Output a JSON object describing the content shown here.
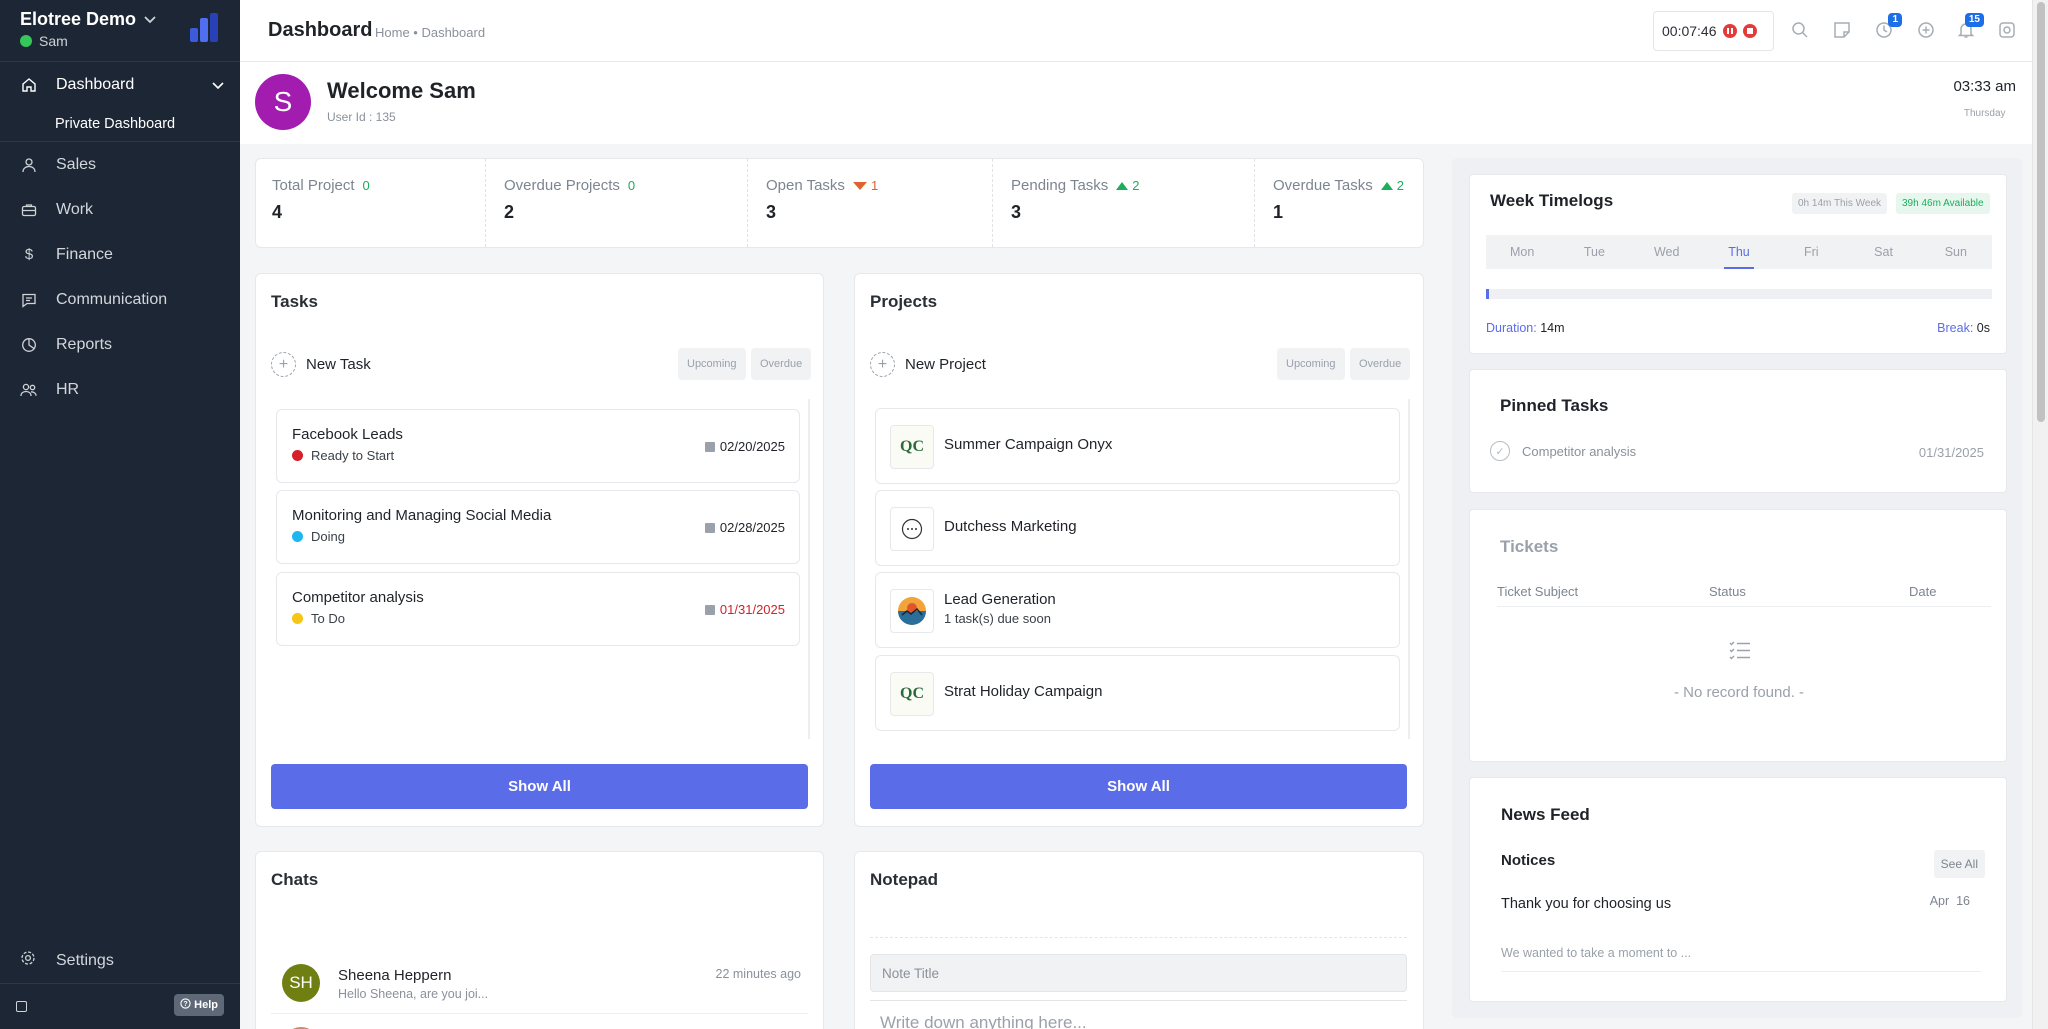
{
  "sidebar": {
    "company": "Elotree Demo",
    "user": "Sam",
    "nav": [
      {
        "label": "Dashboard",
        "icon": "home-icon"
      },
      {
        "label": "Private Dashboard"
      },
      {
        "label": "Sales",
        "icon": "user-icon"
      },
      {
        "label": "Work",
        "icon": "briefcase-icon"
      },
      {
        "label": "Finance",
        "icon": "dollar-icon"
      },
      {
        "label": "Communication",
        "icon": "message-icon"
      },
      {
        "label": "Reports",
        "icon": "pie-chart-icon"
      },
      {
        "label": "HR",
        "icon": "users-icon"
      }
    ],
    "settings": "Settings",
    "help": "Help"
  },
  "topbar": {
    "title": "Dashboard",
    "breadcrumb": "Home • Dashboard",
    "timer": "00:07:46",
    "clock_badge": "1",
    "notif_badge": "15"
  },
  "welcome": {
    "avatar_letter": "S",
    "greeting": "Welcome Sam",
    "user_id": "User Id : 135",
    "time": "03:33 am",
    "day": "Thursday",
    "avatar_color": "#a21caf"
  },
  "stats": [
    {
      "label": "Total Project",
      "delta": "0",
      "trend": "none",
      "value": "4"
    },
    {
      "label": "Overdue Projects",
      "delta": "0",
      "trend": "none",
      "value": "2"
    },
    {
      "label": "Open Tasks",
      "delta": "1",
      "trend": "down",
      "value": "3"
    },
    {
      "label": "Pending Tasks",
      "delta": "2",
      "trend": "up",
      "value": "3"
    },
    {
      "label": "Overdue Tasks",
      "delta": "2",
      "trend": "up",
      "value": "1"
    }
  ],
  "tasks": {
    "title": "Tasks",
    "new_label": "New Task",
    "filter_upcoming": "Upcoming",
    "filter_overdue": "Overdue",
    "items": [
      {
        "name": "Facebook Leads",
        "status": "Ready to Start",
        "status_color": "#d61f26",
        "date": "02/20/2025",
        "overdue": false
      },
      {
        "name": "Monitoring and Managing Social Media",
        "status": "Doing",
        "status_color": "#1fb6f0",
        "date": "02/28/2025",
        "overdue": false
      },
      {
        "name": "Competitor analysis",
        "status": "To Do",
        "status_color": "#f5c518",
        "date": "01/31/2025",
        "overdue": true
      }
    ],
    "show_all": "Show All"
  },
  "projects": {
    "title": "Projects",
    "new_label": "New Project",
    "filter_upcoming": "Upcoming",
    "filter_overdue": "Overdue",
    "items": [
      {
        "name": "Summer Campaign Onyx",
        "sub": "",
        "logo": "QC"
      },
      {
        "name": "Dutchess Marketing",
        "sub": "",
        "logo": "dots"
      },
      {
        "name": "Lead Generation",
        "sub": "1 task(s) due soon",
        "logo": "sunset"
      },
      {
        "name": "Strat Holiday Campaign",
        "sub": "",
        "logo": "QC"
      }
    ],
    "show_all": "Show All"
  },
  "chats": {
    "title": "Chats",
    "items": [
      {
        "initials": "SH",
        "name": "Sheena Heppern",
        "message": "Hello Sheena, are you joi...",
        "time": "22 minutes ago"
      }
    ]
  },
  "notepad": {
    "title": "Notepad",
    "title_placeholder": "Note Title",
    "body_placeholder": "Write down anything here..."
  },
  "timelogs": {
    "title": "Week Timelogs",
    "this_week": "0h 14m This Week",
    "available": "39h 46m Available",
    "days": [
      "Mon",
      "Tue",
      "Wed",
      "Thu",
      "Fri",
      "Sat",
      "Sun"
    ],
    "active_day": "Thu",
    "duration_label": "Duration:",
    "duration": "14m",
    "break_label": "Break:",
    "break": "0s",
    "progress_fraction": 0.006
  },
  "pinned": {
    "title": "Pinned Tasks",
    "items": [
      {
        "name": "Competitor analysis",
        "date": "01/31/2025"
      }
    ]
  },
  "tickets": {
    "title": "Tickets",
    "columns": [
      "Ticket Subject",
      "Status",
      "Date"
    ],
    "empty": "- No record found. -"
  },
  "news": {
    "title": "News Feed",
    "notices_label": "Notices",
    "see_all": "See All",
    "notice_title": "Thank you for choosing us",
    "notice_date": "Apr  16",
    "notice_body": "We wanted to take a moment to ..."
  }
}
